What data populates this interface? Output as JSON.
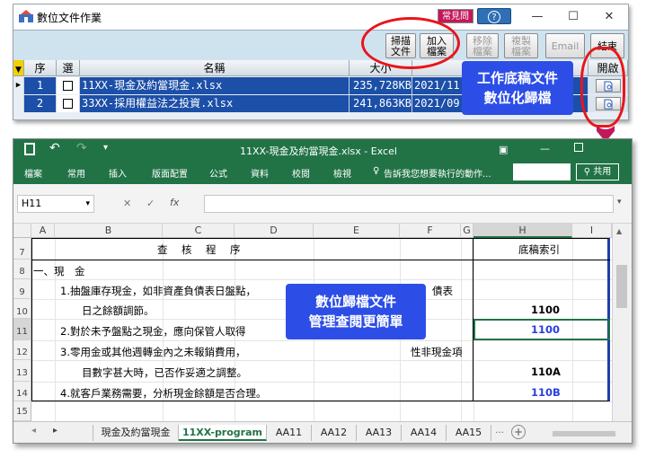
{
  "app": {
    "title": "數位文件作業",
    "faq_label": "常見問題",
    "help_label": "?",
    "win_controls": [
      "—",
      "☐",
      "✕"
    ],
    "toolbar": [
      {
        "line1": "掃描",
        "line2": "文件",
        "disabled": false
      },
      {
        "line1": "加入",
        "line2": "檔案",
        "disabled": false
      },
      {
        "line1": "移除",
        "line2": "檔案",
        "disabled": true
      },
      {
        "line1": "複製",
        "line2": "檔案",
        "disabled": true
      },
      {
        "line1": "Email",
        "line2": "",
        "disabled": true
      },
      {
        "line1": "結束",
        "line2": "",
        "disabled": false
      }
    ],
    "columns": [
      "序",
      "選",
      "名稱",
      "大小",
      "開啟"
    ],
    "rows": [
      {
        "no": "1",
        "name": "11XX-現金及約當現金.xlsx",
        "size": "235,728KB",
        "date": "2021/11"
      },
      {
        "no": "2",
        "name": "33XX-採用權益法之投資.xlsx",
        "size": "241,863KB",
        "date": "2021/09"
      }
    ]
  },
  "callout_top": {
    "line1": "工作底稿文件",
    "line2": "數位化歸檔"
  },
  "callout_mid": {
    "line1": "數位歸檔文件",
    "line2": "管理查閱更簡單"
  },
  "excel": {
    "title": "11XX-現金及約當現金.xlsx - Excel",
    "ribbon_tabs": [
      "檔案",
      "常用",
      "插入",
      "版面配置",
      "公式",
      "資料",
      "校閱",
      "檢視"
    ],
    "tell_me": "告訴我您想要執行的動作...",
    "share": "共用",
    "name_box": "H11",
    "fx": "fx",
    "col_letters": [
      "A",
      "B",
      "C",
      "D",
      "E",
      "F",
      "G",
      "H",
      "I"
    ],
    "row_numbers": [
      "7",
      "8",
      "9",
      "10",
      "11",
      "12",
      "13",
      "14",
      "15"
    ],
    "header_procedure": "查　核　程　序",
    "header_index": "底稿索引",
    "section": "一、現　金",
    "lines": [
      "1.抽盤庫存現金，如非資產負債表日盤點，",
      "日之餘額調節。",
      "2.對於未予盤點之現金，應向保管人取得",
      "3.零用金或其他週轉金內之未報銷費用，",
      "目數字甚大時，已否作妥適之調整。",
      "4.就客戶業務需要，分析現金餘額是否合理。"
    ],
    "line1_tail": "債表",
    "line3_tail": "性非現金項",
    "index": [
      "1100",
      "1100",
      "110A",
      "110B"
    ],
    "sheet_tabs": [
      "現金及約當現金",
      "11XX-program",
      "AA11",
      "AA12",
      "AA13",
      "AA14",
      "AA15"
    ]
  },
  "colors": {
    "excel_green": "#217346",
    "callout_blue": "#2d4ee6",
    "ring_red": "#e8151b",
    "row_select": "#1c4fa8"
  }
}
